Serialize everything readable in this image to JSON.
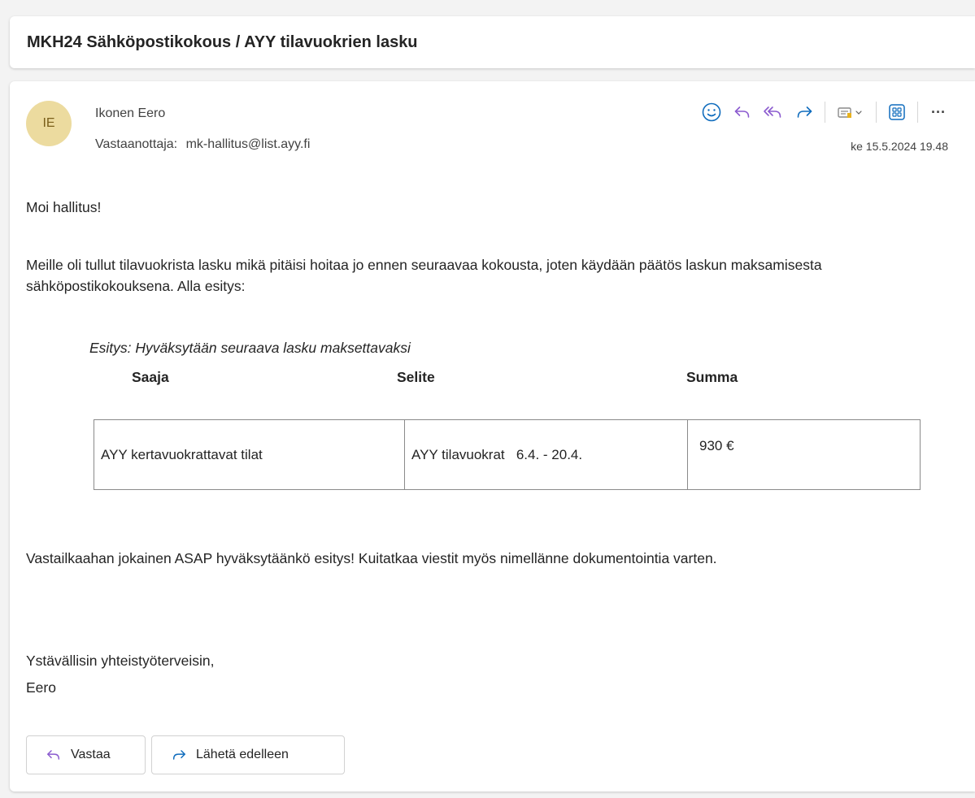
{
  "subject": "MKH24 Sähköpostikokous / AYY tilavuokrien lasku",
  "sender": {
    "initials": "IE",
    "name": "Ikonen Eero"
  },
  "recipient": {
    "label": "Vastaanottaja:",
    "address": "mk-hallitus@list.ayy.fi"
  },
  "date": "ke 15.5.2024 19.48",
  "toolbar": {
    "icons": [
      "emoji-icon",
      "reply-icon",
      "reply-all-icon",
      "forward-icon",
      "tag-icon",
      "apps-icon",
      "more-icon"
    ],
    "more_label": "···"
  },
  "body": {
    "greeting": "Moi hallitus!",
    "paragraph1": "Meille oli tullut tilavuokrista lasku mikä pitäisi hoitaa jo ennen seuraavaa kokousta, joten käydään päätös laskun maksamisesta sähköpostikokouksena. Alla esitys:",
    "proposal": "Esitys: Hyväksytään seuraava lasku maksettavaksi",
    "table": {
      "headers": [
        "Saaja",
        "Selite",
        "Summa"
      ],
      "rows": [
        [
          "AYY kertavuokrattavat tilat",
          "AYY tilavuokrat   6.4. - 20.4.",
          "930 €"
        ]
      ]
    },
    "paragraph2": "Vastailkaahan jokainen ASAP hyväksytäänkö esitys! Kuitatkaa viestit myös nimellänne dokumentointia varten.",
    "closing": "Ystävällisin yhteistyöterveisin,",
    "signature": "Eero"
  },
  "actions": {
    "reply": "Vastaa",
    "forward": "Lähetä edelleen"
  },
  "colors": {
    "accent": "#0f6cbd",
    "avatar_bg": "#ecdb9f",
    "avatar_text": "#7a5f1a",
    "reply_icon": "#8b5bcf"
  }
}
